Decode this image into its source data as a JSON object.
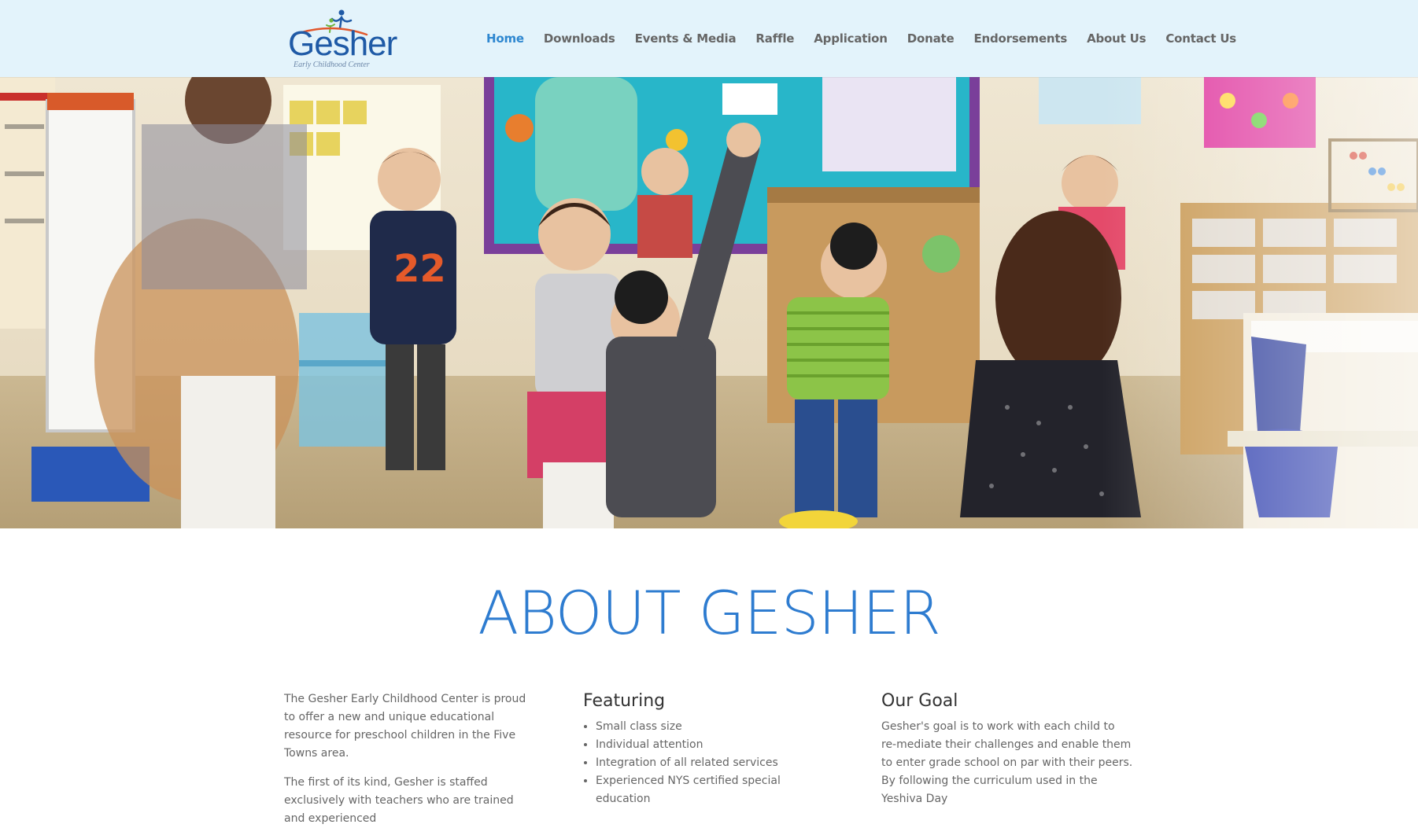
{
  "header": {
    "logo": {
      "wordmark": "Gesher",
      "tagline": "Early Childhood Center"
    },
    "nav": [
      {
        "label": "Home",
        "active": true
      },
      {
        "label": "Downloads",
        "active": false
      },
      {
        "label": "Events & Media",
        "active": false
      },
      {
        "label": "Raffle",
        "active": false
      },
      {
        "label": "Application",
        "active": false
      },
      {
        "label": "Donate",
        "active": false
      },
      {
        "label": "Endorsements",
        "active": false
      },
      {
        "label": "About Us",
        "active": false
      },
      {
        "label": "Contact Us",
        "active": false
      }
    ]
  },
  "hero": {
    "image": "children-dancing-in-classroom"
  },
  "about": {
    "title": "ABOUT GESHER",
    "intro": {
      "paragraph_1": "The Gesher Early Childhood Center is proud to offer a new and unique educational resource for preschool children in the Five Towns area.",
      "paragraph_2": "The first of its kind, Gesher is staffed exclusively with teachers who are trained and experienced"
    },
    "featuring": {
      "heading": "Featuring",
      "items": [
        "Small class size",
        "Individual attention",
        "Integration of all related services",
        "Experienced NYS certified special education"
      ]
    },
    "goal": {
      "heading": "Our Goal",
      "text": "Gesher's goal is to work with each child to re-mediate their challenges and enable them to enter grade school on par with their peers. By following the curriculum used in the Yeshiva Day"
    }
  },
  "colors": {
    "header_bg": "#e3f3fb",
    "accent": "#2e7cd0",
    "nav_active": "#2e87d0",
    "text": "#666666"
  }
}
